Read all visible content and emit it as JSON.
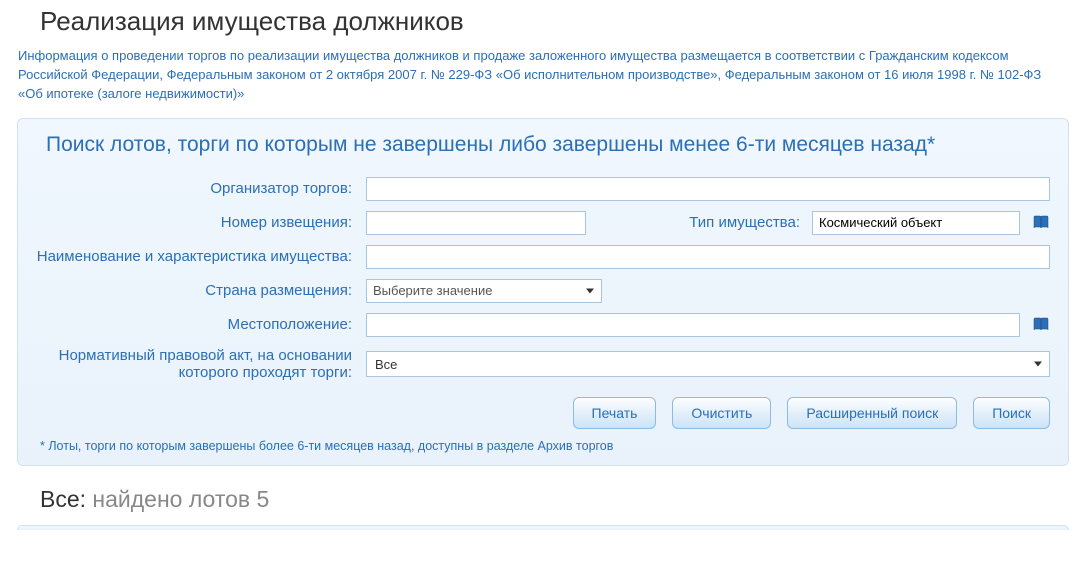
{
  "page_title": "Реализация имущества должников",
  "intro": "Информация о проведении торгов по реализации имущества должников и продаже заложенного имущества размещается в соответствии с Гражданским кодексом Российской Федерации, Федеральным законом от 2 октября 2007 г. № 229-ФЗ «Об исполнительном производстве», Федеральным законом от 16 июля 1998 г. № 102-ФЗ «Об ипотеке (залоге недвижимости)»",
  "panel": {
    "heading": "Поиск лотов, торги по которым не завершены либо завершены менее 6-ти месяцев назад*",
    "labels": {
      "organizer": "Организатор торгов:",
      "notice_number": "Номер извещения:",
      "property_type": "Тип имущества:",
      "property_name": "Наименование и характеристика имущества:",
      "country": "Страна размещения:",
      "location": "Местоположение:",
      "act": "Нормативный правовой акт, на основании которого проходят торги:"
    },
    "values": {
      "organizer": "",
      "notice_number": "",
      "property_type": "Космический объект",
      "property_name": "",
      "country_placeholder": "Выберите значение",
      "location": "",
      "act_selected": "Все"
    },
    "buttons": {
      "print": "Печать",
      "clear": "Очистить",
      "advanced": "Расширенный поиск",
      "search": "Поиск"
    },
    "footnote": "* Лоты, торги по которым завершены более 6-ти месяцев назад, доступны в разделе Архив торгов"
  },
  "results": {
    "prefix": "Все:",
    "text": " найдено лотов 5"
  }
}
